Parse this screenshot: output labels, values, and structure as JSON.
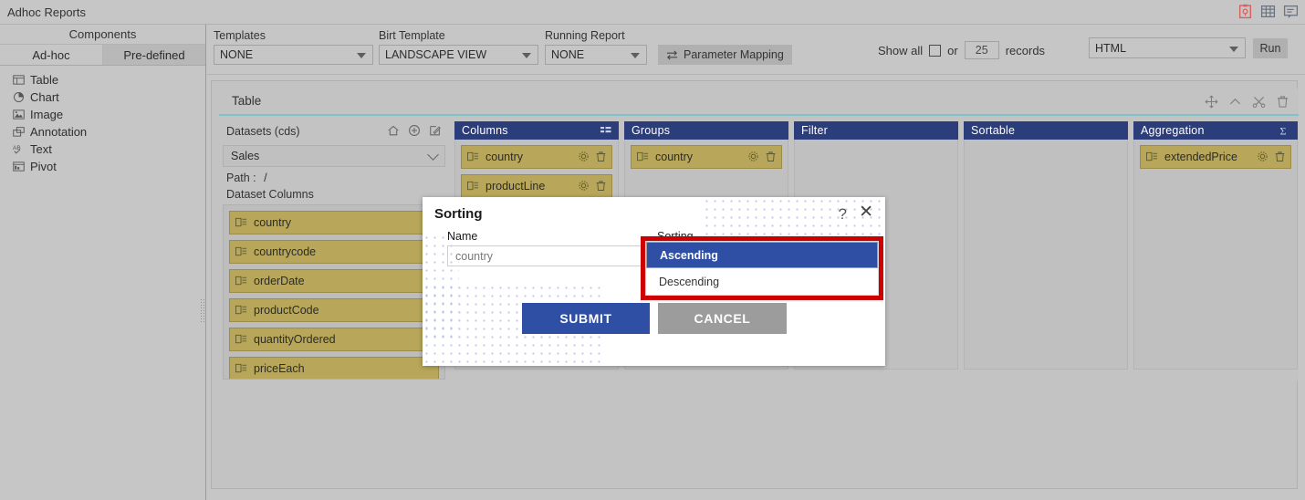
{
  "window": {
    "title": "Adhoc Reports",
    "icons": [
      "report-red-icon",
      "table-icon",
      "comment-icon"
    ]
  },
  "sidebar": {
    "header": "Components",
    "tabs": [
      {
        "label": "Ad-hoc",
        "active": true
      },
      {
        "label": "Pre-defined",
        "active": false
      }
    ],
    "items": [
      {
        "label": "Table",
        "icon": "table-icon"
      },
      {
        "label": "Chart",
        "icon": "chart-pie-icon"
      },
      {
        "label": "Image",
        "icon": "image-icon"
      },
      {
        "label": "Annotation",
        "icon": "annotation-icon"
      },
      {
        "label": "Text",
        "icon": "text-ab-icon"
      },
      {
        "label": "Pivot",
        "icon": "pivot-icon"
      }
    ]
  },
  "toolbar": {
    "templates": {
      "label": "Templates",
      "value": "NONE"
    },
    "birt_template": {
      "label": "Birt Template",
      "value": "LANDSCAPE VIEW"
    },
    "running_report": {
      "label": "Running Report",
      "value": "NONE"
    },
    "parameter_mapping": "Parameter Mapping",
    "show_all_label": "Show all",
    "or_label": "or",
    "records_value": "25",
    "records_label": "records",
    "format": "HTML",
    "run": "Run"
  },
  "panel": {
    "title": "Table",
    "header_icons": [
      "move-icon",
      "chevron-up-icon",
      "settings-tools-icon",
      "trash-icon"
    ]
  },
  "datasets": {
    "label": "Datasets (cds)",
    "header_icons": [
      "home-icon",
      "plus-circle-icon",
      "edit-square-icon"
    ],
    "selected": "Sales",
    "path_label": "Path :",
    "path_value": "/",
    "columns_label": "Dataset Columns",
    "columns": [
      "country",
      "countrycode",
      "orderDate",
      "productCode",
      "quantityOrdered",
      "priceEach"
    ]
  },
  "columns_panel": {
    "title": "Columns",
    "icon": "list-grid-icon",
    "items": [
      "country",
      "productLine"
    ]
  },
  "groups_panel": {
    "title": "Groups",
    "items": [
      "country"
    ]
  },
  "filter_panel": {
    "title": "Filter",
    "items": []
  },
  "sortable_panel": {
    "title": "Sortable",
    "items": []
  },
  "aggregation_panel": {
    "title": "Aggregation",
    "icon": "sigma-icon",
    "items": [
      "extendedPrice"
    ]
  },
  "modal": {
    "title": "Sorting",
    "help_icon": "question-mark-icon",
    "close_icon": "close-icon",
    "name_label": "Name",
    "name_value": "country",
    "sorting_label": "Sorting",
    "submit": "SUBMIT",
    "cancel": "CANCEL"
  },
  "dropdown": {
    "options": [
      {
        "label": "Ascending",
        "selected": true
      },
      {
        "label": "Descending",
        "selected": false
      }
    ],
    "highlight_color": "#cc0000"
  },
  "colors": {
    "panel_header_blue": "#2b3d7b",
    "accent_blue": "#2e4fa3",
    "chip_gold": "#b8a75a",
    "app_gray": "#c6c6c6",
    "teal_rule": "#7fc2c8"
  }
}
